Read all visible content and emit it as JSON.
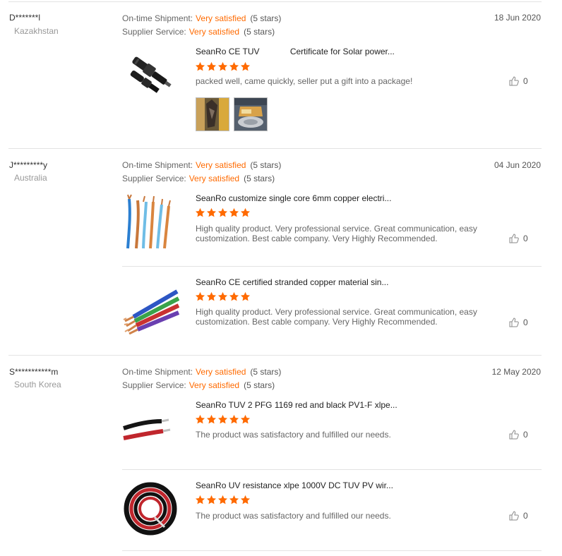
{
  "labels": {
    "ontime": "On-time Shipment:",
    "supplier": "Supplier Service:"
  },
  "reviews": [
    {
      "name": "D*******l",
      "country": "Kazakhstan",
      "date": "18 Jun 2020",
      "ontime_value": "Very satisfied",
      "ontime_stars": "(5 stars)",
      "supplier_value": "Very satisfied",
      "supplier_stars": "(5 stars)",
      "products": [
        {
          "title": "SeanRo CE TUV             Certificate for Solar power...",
          "rating": 5,
          "comment": "packed well, came quickly, seller put a gift into a package!",
          "likes": "0",
          "image_icon": "mc4-connector-icon",
          "photos": [
            "review-photo-icon",
            "review-photo-icon"
          ]
        }
      ]
    },
    {
      "name": "J*********y",
      "country": "Australia",
      "date": "04 Jun 2020",
      "ontime_value": "Very satisfied",
      "ontime_stars": "(5 stars)",
      "supplier_value": "Very satisfied",
      "supplier_stars": "(5 stars)",
      "products": [
        {
          "title": "SeanRo customize single core 6mm copper electri...",
          "rating": 5,
          "comment": "High quality product. Very professional service. Great communication, easy customization. Best cable company. Very Highly Recommended.",
          "likes": "0",
          "image_icon": "copper-wires-icon"
        },
        {
          "title": "SeanRo CE certified stranded copper material sin...",
          "rating": 5,
          "comment": "High quality product. Very professional service. Great communication, easy customization. Best cable company. Very Highly Recommended.",
          "likes": "0",
          "image_icon": "stranded-wires-icon"
        }
      ]
    },
    {
      "name": "S***********m",
      "country": "South Korea",
      "date": "12 May 2020",
      "ontime_value": "Very satisfied",
      "ontime_stars": "(5 stars)",
      "supplier_value": "Very satisfied",
      "supplier_stars": "(5 stars)",
      "products": [
        {
          "title": "SeanRo TUV 2 PFG 1169 red and black PV1-F xlpe...",
          "rating": 5,
          "comment": "The product was satisfactory and fulfilled our needs.",
          "likes": "0",
          "image_icon": "red-black-cable-icon"
        },
        {
          "title": "SeanRo UV resistance xlpe 1000V DC TUV PV wir...",
          "rating": 5,
          "comment": "The product was satisfactory and fulfilled our needs.",
          "likes": "0",
          "image_icon": "cable-reel-icon"
        }
      ]
    }
  ],
  "colors": {
    "accent": "#ff6a00",
    "star": "#ff6a00",
    "divider": "#e3e3e3"
  }
}
